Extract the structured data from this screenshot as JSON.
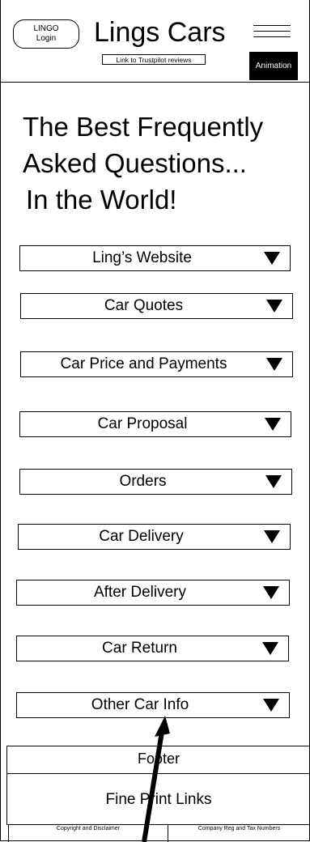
{
  "header": {
    "login_line1": "LINGO",
    "login_line2": "Login",
    "brand": "Lings Cars",
    "trustpilot_link": "Link to Trustpilot reviews",
    "animation_label": "Animation"
  },
  "title": {
    "line1": "The Best Frequently",
    "line2": "Asked Questions...",
    "line3": "In the World!"
  },
  "faq": [
    {
      "label": "Ling’s Website"
    },
    {
      "label": "Car Quotes"
    },
    {
      "label": "Car Price and Payments"
    },
    {
      "label": "Car Proposal"
    },
    {
      "label": "Orders"
    },
    {
      "label": "Car Delivery"
    },
    {
      "label": "After Delivery"
    },
    {
      "label": "Car Return"
    },
    {
      "label": "Other Car Info"
    }
  ],
  "footer": {
    "label": "Footer",
    "fine_print": "Fine Print Links",
    "copyright": "Copyright and Disclaimer",
    "company_reg": "Company Reg and Tax Numbers"
  },
  "icons": {
    "dropdown": "triangle-down-icon",
    "menu": "hamburger-icon"
  }
}
